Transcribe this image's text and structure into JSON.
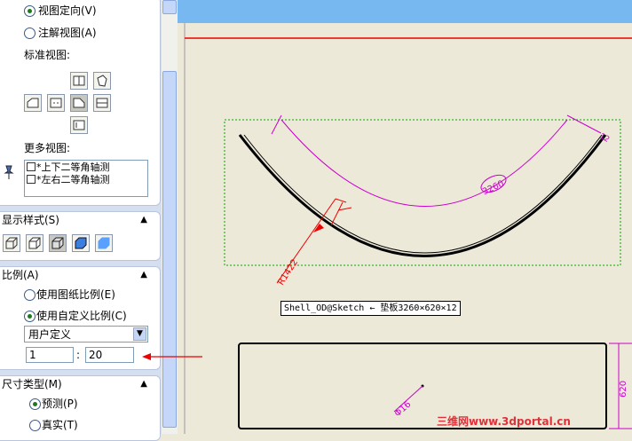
{
  "orientation": {
    "view_orientation_label": "视图定向(V)",
    "annotation_view_label": "注解视图(A)",
    "standard_views_label": "标准视图:",
    "more_views_label": "更多视图:",
    "more_views": [
      "*上下二等角轴测",
      "*左右二等角轴测"
    ]
  },
  "display_style": {
    "title": "显示样式(S)"
  },
  "scale": {
    "title": "比例(A)",
    "use_sheet_scale": "使用图纸比例(E)",
    "use_custom_scale": "使用自定义比例(C)",
    "custom_option": "用户定义",
    "numerator": "1",
    "colon": ":",
    "denominator": "20"
  },
  "dimension_type": {
    "title": "尺寸类型(M)",
    "projected": "预测(P)",
    "true": "真实(T)"
  },
  "drawing": {
    "arc_length_dim": "3260",
    "radius_dim": "R1422",
    "thickness_dim": "12",
    "diameter_dim": "Φ16",
    "height_dim": "620",
    "callout": "Shell_OD@Sketch ← 垫板3260×620×12"
  },
  "watermark": "三维网www.3dportal.cn",
  "colors": {
    "dimension": "#cc00cc",
    "annotation_red": "#ee0000",
    "sketch_box": "#00aa00",
    "canvas_top": "#78b8f0"
  }
}
